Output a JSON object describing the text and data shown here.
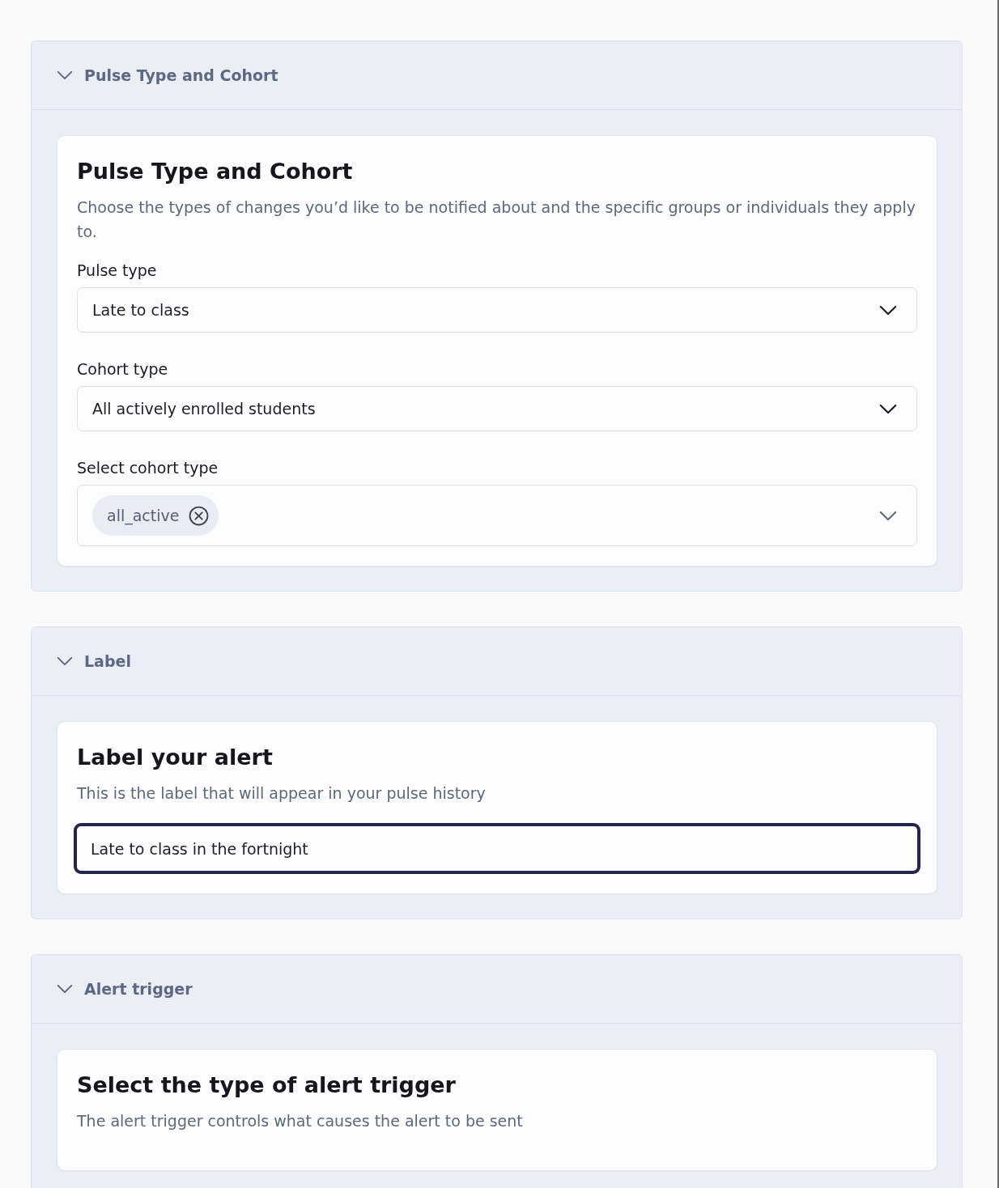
{
  "sections": [
    {
      "title": "Pulse Type and Cohort",
      "expanded": true,
      "card": {
        "heading": "Pulse Type and Cohort",
        "description": "Choose the types of changes you’d like to be notified about and the specific groups or individuals they apply to.",
        "fields": [
          {
            "kind": "select",
            "label": "Pulse type",
            "value": "Late to class"
          },
          {
            "kind": "select",
            "label": "Cohort type",
            "value": "All actively enrolled students"
          },
          {
            "kind": "multiselect",
            "label": "Select cohort type",
            "tags": [
              "all_active"
            ]
          }
        ]
      }
    },
    {
      "title": "Label",
      "expanded": true,
      "card": {
        "heading": "Label your alert",
        "description": "This is the label that will appear in your pulse history",
        "fields": [
          {
            "kind": "text",
            "value": "Late to class in the fortnight",
            "focused": true
          }
        ]
      }
    },
    {
      "title": "Alert trigger",
      "expanded": true,
      "card": {
        "heading": "Select the type of alert trigger",
        "description": "The alert trigger controls what causes the alert to be sent"
      }
    }
  ]
}
